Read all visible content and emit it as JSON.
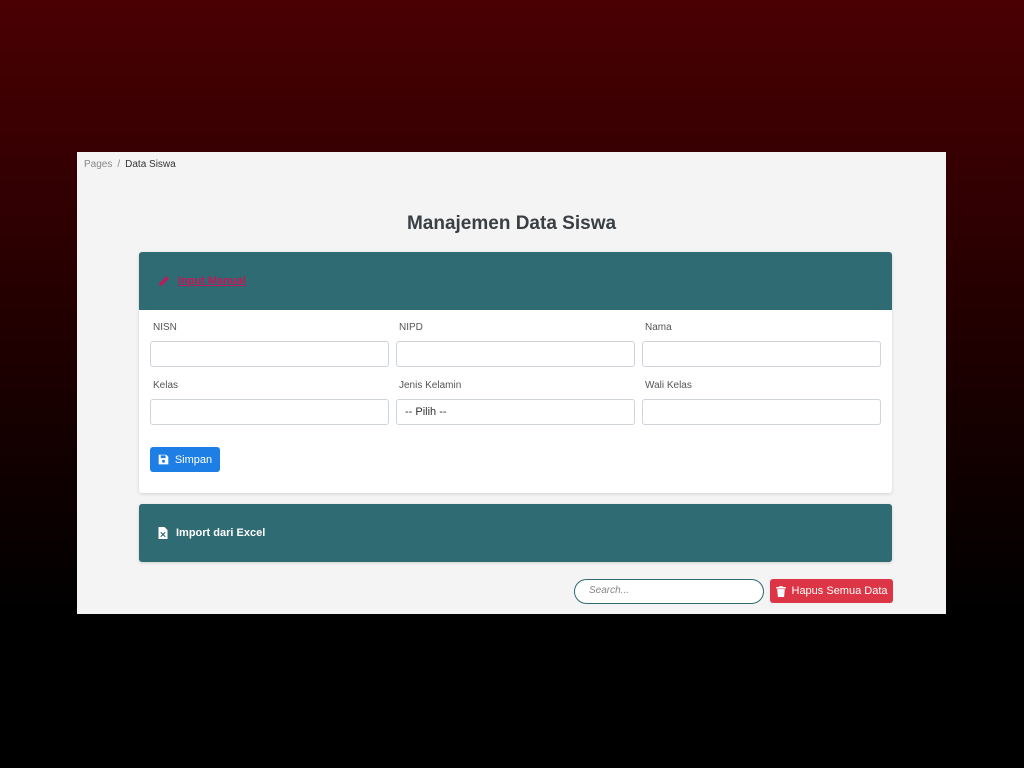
{
  "breadcrumb": {
    "root": "Pages",
    "separator": "/",
    "current": "Data Siswa"
  },
  "page": {
    "title": "Manajemen Data Siswa"
  },
  "manual": {
    "header_label": "Input Manual",
    "fields": {
      "nisn": {
        "label": "NISN",
        "value": ""
      },
      "nipd": {
        "label": "NIPD",
        "value": ""
      },
      "nama": {
        "label": "Nama",
        "value": ""
      },
      "kelas": {
        "label": "Kelas",
        "value": ""
      },
      "jenis_kelamin": {
        "label": "Jenis Kelamin",
        "value": "-- Pilih --"
      },
      "wali_kelas": {
        "label": "Wali Kelas",
        "value": ""
      }
    },
    "save_label": "Simpan"
  },
  "excel": {
    "header_label": "Import dari Excel"
  },
  "toolbar": {
    "search_placeholder": "Search...",
    "delete_all_label": "Hapus Semua Data"
  },
  "colors": {
    "header_bg": "#2f6b72",
    "primary": "#1d7fe6",
    "danger": "#dc3545",
    "link": "#c2185b"
  },
  "icons": {
    "manual": "pencil-icon",
    "save": "floppy-disk-icon",
    "excel": "excel-file-icon",
    "delete": "trash-icon"
  }
}
